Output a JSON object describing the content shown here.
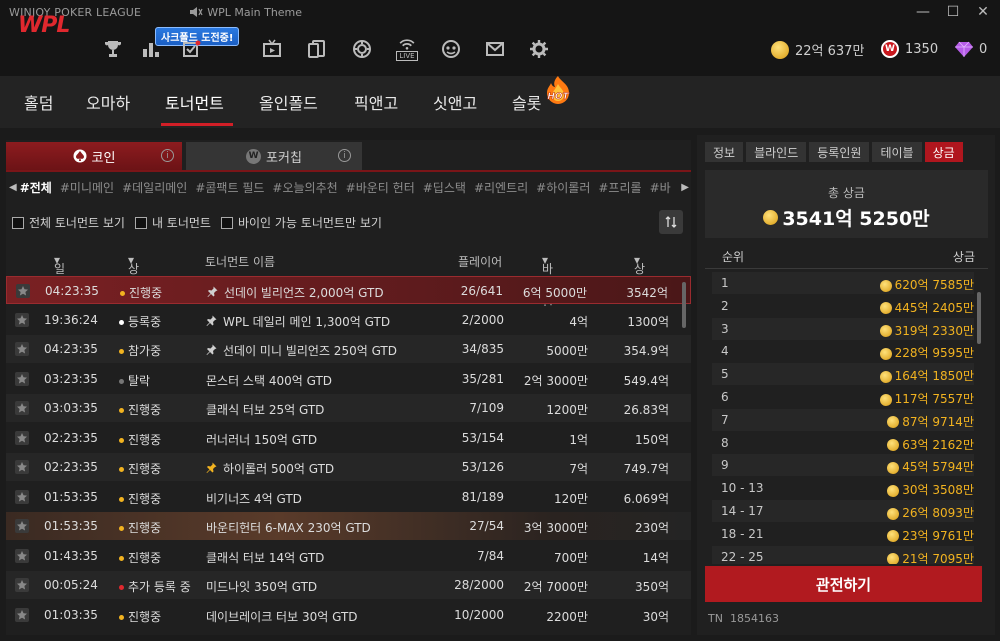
{
  "window": {
    "app_title": "WINJOY POKER LEAGUE",
    "sound_label": "WPL Main Theme"
  },
  "topbar": {
    "logo": "WPL",
    "event_badge": "사크폴드 도전중!",
    "icons": [
      "trophy-icon",
      "ranking-icon",
      "mission-icon",
      "tv-icon",
      "cards-icon",
      "chip-icon",
      "live-icon",
      "emoji-icon",
      "mail-icon",
      "settings-icon"
    ],
    "live_label": "LIVE",
    "gold_balance": "22억 637만",
    "wpl_badge": "W",
    "wpl_balance": "1350",
    "diamond_balance": "0"
  },
  "nav": {
    "items": [
      "홀덤",
      "오마하",
      "토너먼트",
      "올인폴드",
      "픽앤고",
      "싯앤고",
      "슬롯"
    ],
    "active_index": 2,
    "hot_label": "HOT"
  },
  "coin_tabs": {
    "coin": "코인",
    "pokerchip": "포커칩",
    "info_glyph": "i"
  },
  "categories": [
    "#전체",
    "#미니메인",
    "#데일리메인",
    "#콤팩트 필드",
    "#오늘의추천",
    "#바운티 헌터",
    "#딥스택",
    "#리엔트리",
    "#하이롤러",
    "#프리롤",
    "#바"
  ],
  "filters": {
    "all": "전체 토너먼트 보기",
    "mine": "내 토너먼트",
    "buyin_only": "바이인 가능 토너먼트만 보기"
  },
  "table": {
    "headers": {
      "time": "일시",
      "status": "상태",
      "name": "토너먼트 이름",
      "players": "플레이어",
      "buyin": "바이인",
      "prize": "상금"
    },
    "rows": [
      {
        "time": "04:23:35",
        "status": "진행중",
        "status_color": "#f2b320",
        "pin": true,
        "name": "선데이 빌리언즈 2,000억 GTD",
        "players": "26/641",
        "buyin": "6억 5000만",
        "prize": "3542억",
        "style": "sel"
      },
      {
        "time": "19:36:24",
        "status": "등록중",
        "status_color": "#ffffff",
        "pin": true,
        "name": "WPL 데일리 메인 1,300억 GTD",
        "players": "2/2000",
        "buyin": "4억",
        "prize": "1300억",
        "style": "even"
      },
      {
        "time": "04:23:35",
        "status": "참가중",
        "status_color": "#f2b320",
        "pin": true,
        "name": "선데이 미니 빌리언즈 250억 GTD",
        "players": "34/835",
        "buyin": "5000만",
        "prize": "354.9억",
        "style": "odd"
      },
      {
        "time": "03:23:35",
        "status": "탈락",
        "status_color": "#777777",
        "pin": false,
        "name": "몬스터 스택 400억 GTD",
        "players": "35/281",
        "buyin": "2억 3000만",
        "prize": "549.4억",
        "style": "even"
      },
      {
        "time": "03:03:35",
        "status": "진행중",
        "status_color": "#f2b320",
        "pin": false,
        "name": "클래식 터보 25억 GTD",
        "players": "7/109",
        "buyin": "1200만",
        "prize": "26.83억",
        "style": "odd"
      },
      {
        "time": "02:23:35",
        "status": "진행중",
        "status_color": "#f2b320",
        "pin": false,
        "name": "러너러너 150억 GTD",
        "players": "53/154",
        "buyin": "1억",
        "prize": "150억",
        "style": "even"
      },
      {
        "time": "02:23:35",
        "status": "진행중",
        "status_color": "#f2b320",
        "pin": true,
        "name": "하이롤러 500억 GTD",
        "players": "53/126",
        "buyin": "7억",
        "prize": "749.7억",
        "style": "odd",
        "pin_gold": true
      },
      {
        "time": "01:53:35",
        "status": "진행중",
        "status_color": "#f2b320",
        "pin": false,
        "name": "비기너즈 4억 GTD",
        "players": "81/189",
        "buyin": "120만",
        "prize": "6.069억",
        "style": "even"
      },
      {
        "time": "01:53:35",
        "status": "진행중",
        "status_color": "#f2b320",
        "pin": false,
        "name": "바운티헌터 6-MAX 230억 GTD",
        "players": "27/54",
        "buyin": "3억 3000만",
        "prize": "230억",
        "style": "glow"
      },
      {
        "time": "01:43:35",
        "status": "진행중",
        "status_color": "#f2b320",
        "pin": false,
        "name": "클래식 터보 14억 GTD",
        "players": "7/84",
        "buyin": "700만",
        "prize": "14억",
        "style": "even"
      },
      {
        "time": "00:05:24",
        "status": "추가 등록 중",
        "status_color": "#e0282e",
        "pin": false,
        "name": "미드나잇 350억 GTD",
        "players": "28/2000",
        "buyin": "2억 7000만",
        "prize": "350억",
        "style": "odd"
      },
      {
        "time": "01:03:35",
        "status": "진행중",
        "status_color": "#f2b320",
        "pin": false,
        "name": "데이브레이크 터보 30억 GTD",
        "players": "10/2000",
        "buyin": "2200만",
        "prize": "30억",
        "style": "even"
      }
    ]
  },
  "right": {
    "tabs": [
      "정보",
      "블라인드",
      "등록인원",
      "테이블",
      "상금"
    ],
    "active_tab": 4,
    "total_label": "총 상금",
    "total_value": "3541억 5250만",
    "rank_header": "순위",
    "prize_header": "상금",
    "prizes": [
      {
        "rank": "1",
        "amount": "620억 7585만"
      },
      {
        "rank": "2",
        "amount": "445억 2405만"
      },
      {
        "rank": "3",
        "amount": "319억 2330만"
      },
      {
        "rank": "4",
        "amount": "228억 9595만"
      },
      {
        "rank": "5",
        "amount": "164억 1850만"
      },
      {
        "rank": "6",
        "amount": "117억 7557만"
      },
      {
        "rank": "7",
        "amount": "87억 9714만"
      },
      {
        "rank": "8",
        "amount": "63억 2162만"
      },
      {
        "rank": "9",
        "amount": "45억 5794만"
      },
      {
        "rank": "10 - 13",
        "amount": "30억 3508만"
      },
      {
        "rank": "14 - 17",
        "amount": "26억 8093만"
      },
      {
        "rank": "18 - 21",
        "amount": "23억 9761만"
      },
      {
        "rank": "22 - 25",
        "amount": "21억 7095만"
      }
    ],
    "watch_button": "관전하기",
    "tn_label": "TN",
    "tn_value": "1854163"
  }
}
